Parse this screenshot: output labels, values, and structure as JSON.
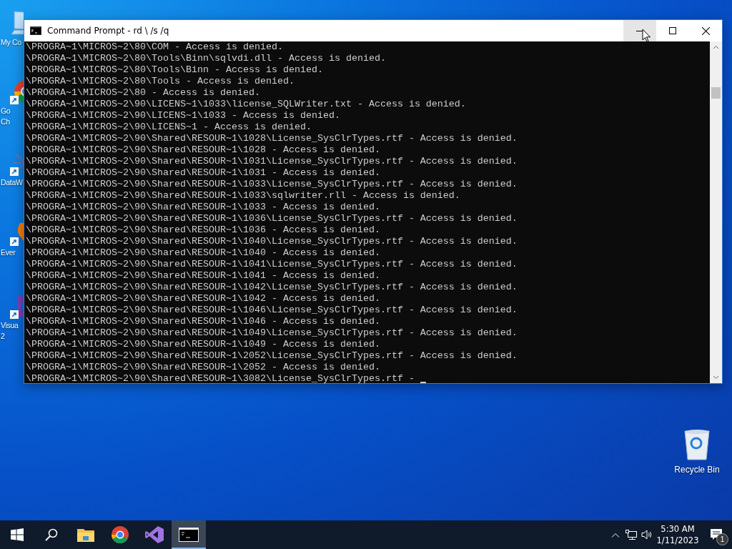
{
  "desktop": {
    "icons": [
      {
        "kind": "computer",
        "label_lines": [
          "My Co"
        ],
        "shortcut": false
      },
      {
        "kind": "chrome",
        "label_lines": [
          "Go",
          "Ch"
        ],
        "shortcut": true
      },
      {
        "kind": "data",
        "label_lines": [
          "DataW"
        ],
        "shortcut": true
      },
      {
        "kind": "evernote",
        "label_lines": [
          "Ever"
        ],
        "shortcut": true
      },
      {
        "kind": "visual-studio",
        "label_lines": [
          "Visua",
          "2"
        ],
        "shortcut": true
      }
    ],
    "recycle_bin": {
      "label": "Recycle Bin"
    }
  },
  "window": {
    "title": "Command Prompt - rd \\ /s /q",
    "controls": [
      {
        "kind": "minimize",
        "hovered": true
      },
      {
        "kind": "maximize",
        "hovered": false
      },
      {
        "kind": "close",
        "hovered": false
      }
    ],
    "console_lines": [
      "\\PROGRA~1\\MICROS~2\\80\\COM - Access is denied.",
      "\\PROGRA~1\\MICROS~2\\80\\Tools\\Binn\\sqlvdi.dll - Access is denied.",
      "\\PROGRA~1\\MICROS~2\\80\\Tools\\Binn - Access is denied.",
      "\\PROGRA~1\\MICROS~2\\80\\Tools - Access is denied.",
      "\\PROGRA~1\\MICROS~2\\80 - Access is denied.",
      "\\PROGRA~1\\MICROS~2\\90\\LICENS~1\\1033\\license_SQLWriter.txt - Access is denied.",
      "\\PROGRA~1\\MICROS~2\\90\\LICENS~1\\1033 - Access is denied.",
      "\\PROGRA~1\\MICROS~2\\90\\LICENS~1 - Access is denied.",
      "\\PROGRA~1\\MICROS~2\\90\\Shared\\RESOUR~1\\1028\\License_SysClrTypes.rtf - Access is denied.",
      "\\PROGRA~1\\MICROS~2\\90\\Shared\\RESOUR~1\\1028 - Access is denied.",
      "\\PROGRA~1\\MICROS~2\\90\\Shared\\RESOUR~1\\1031\\License_SysClrTypes.rtf - Access is denied.",
      "\\PROGRA~1\\MICROS~2\\90\\Shared\\RESOUR~1\\1031 - Access is denied.",
      "\\PROGRA~1\\MICROS~2\\90\\Shared\\RESOUR~1\\1033\\License_SysClrTypes.rtf - Access is denied.",
      "\\PROGRA~1\\MICROS~2\\90\\Shared\\RESOUR~1\\1033\\sqlwriter.rll - Access is denied.",
      "\\PROGRA~1\\MICROS~2\\90\\Shared\\RESOUR~1\\1033 - Access is denied.",
      "\\PROGRA~1\\MICROS~2\\90\\Shared\\RESOUR~1\\1036\\License_SysClrTypes.rtf - Access is denied.",
      "\\PROGRA~1\\MICROS~2\\90\\Shared\\RESOUR~1\\1036 - Access is denied.",
      "\\PROGRA~1\\MICROS~2\\90\\Shared\\RESOUR~1\\1040\\License_SysClrTypes.rtf - Access is denied.",
      "\\PROGRA~1\\MICROS~2\\90\\Shared\\RESOUR~1\\1040 - Access is denied.",
      "\\PROGRA~1\\MICROS~2\\90\\Shared\\RESOUR~1\\1041\\License_SysClrTypes.rtf - Access is denied.",
      "\\PROGRA~1\\MICROS~2\\90\\Shared\\RESOUR~1\\1041 - Access is denied.",
      "\\PROGRA~1\\MICROS~2\\90\\Shared\\RESOUR~1\\1042\\License_SysClrTypes.rtf - Access is denied.",
      "\\PROGRA~1\\MICROS~2\\90\\Shared\\RESOUR~1\\1042 - Access is denied.",
      "\\PROGRA~1\\MICROS~2\\90\\Shared\\RESOUR~1\\1046\\License_SysClrTypes.rtf - Access is denied.",
      "\\PROGRA~1\\MICROS~2\\90\\Shared\\RESOUR~1\\1046 - Access is denied.",
      "\\PROGRA~1\\MICROS~2\\90\\Shared\\RESOUR~1\\1049\\License_SysClrTypes.rtf - Access is denied.",
      "\\PROGRA~1\\MICROS~2\\90\\Shared\\RESOUR~1\\1049 - Access is denied.",
      "\\PROGRA~1\\MICROS~2\\90\\Shared\\RESOUR~1\\2052\\License_SysClrTypes.rtf - Access is denied.",
      "\\PROGRA~1\\MICROS~2\\90\\Shared\\RESOUR~1\\2052 - Access is denied.",
      "\\PROGRA~1\\MICROS~2\\90\\Shared\\RESOUR~1\\3082\\License_SysClrTypes.rtf -"
    ]
  },
  "taskbar": {
    "apps": [
      {
        "kind": "start",
        "selected": false
      },
      {
        "kind": "search",
        "selected": false
      },
      {
        "kind": "explorer",
        "selected": false
      },
      {
        "kind": "chrome",
        "selected": false
      },
      {
        "kind": "visual-studio",
        "selected": false
      },
      {
        "kind": "cmd",
        "selected": true
      }
    ],
    "time": "5:30 AM",
    "date": "1/11/2023",
    "notification_count": "1"
  }
}
